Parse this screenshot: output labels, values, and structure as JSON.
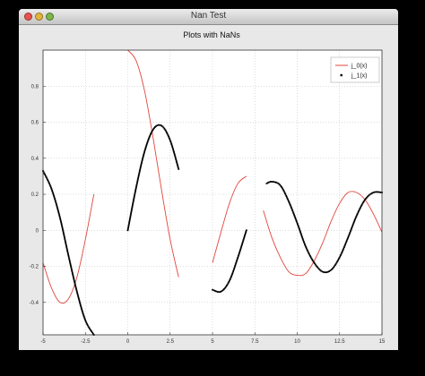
{
  "window": {
    "title": "Nan Test"
  },
  "chart_data": {
    "type": "line",
    "title": "Plots with NaNs",
    "xlabel": "",
    "ylabel": "",
    "xlim": [
      -5,
      15
    ],
    "ylim": [
      -0.58,
      1.0
    ],
    "grid": true,
    "legend_position": "top-right",
    "xticks": [
      -5,
      -2.5,
      0,
      2.5,
      5,
      7.5,
      10,
      12.5,
      15
    ],
    "xtick_labels": [
      "-5",
      "-2.5",
      "0",
      "2.5",
      "5",
      "7.5",
      "10",
      "12.5",
      "15"
    ],
    "yticks": [
      -0.4,
      -0.2,
      0,
      0.2,
      0.4,
      0.6,
      0.8
    ],
    "ytick_labels": [
      "-0.4",
      "-0.2",
      "0",
      "0.2",
      "0.4",
      "0.6",
      "0.8"
    ],
    "series": [
      {
        "name": "j_0(x)",
        "style": "line",
        "color": "#e0453c",
        "segments": [
          {
            "x": [
              -5.0,
              -4.5,
              -4.0,
              -3.5,
              -3.0,
              -2.5,
              -2.0
            ],
            "y": [
              -0.18,
              -0.32,
              -0.4,
              -0.38,
              -0.26,
              -0.05,
              0.2
            ]
          },
          {
            "x": [
              0.0,
              0.5,
              1.0,
              1.5,
              2.0,
              2.5,
              3.0
            ],
            "y": [
              1.0,
              0.94,
              0.77,
              0.51,
              0.22,
              -0.05,
              -0.26
            ]
          },
          {
            "x": [
              5.0,
              5.5,
              6.0,
              6.5,
              7.0
            ],
            "y": [
              -0.18,
              -0.01,
              0.15,
              0.26,
              0.3
            ]
          },
          {
            "x": [
              8.0,
              8.5,
              9.0,
              9.5,
              10.0,
              10.5,
              11.0,
              11.5,
              12.0,
              12.5,
              13.0,
              13.5,
              14.0,
              14.5,
              15.0
            ],
            "y": [
              0.11,
              -0.04,
              -0.15,
              -0.23,
              -0.25,
              -0.24,
              -0.17,
              -0.07,
              0.05,
              0.15,
              0.21,
              0.21,
              0.17,
              0.09,
              -0.01
            ]
          }
        ]
      },
      {
        "name": "j_1(x)",
        "style": "markers",
        "color": "#000000",
        "segments": [
          {
            "x": [
              -5.0,
              -4.5,
              -4.0,
              -3.5,
              -3.0,
              -2.5,
              -2.0
            ],
            "y": [
              0.33,
              0.23,
              0.07,
              -0.14,
              -0.34,
              -0.5,
              -0.58
            ]
          },
          {
            "x": [
              0.0,
              0.5,
              1.0,
              1.5,
              2.0,
              2.5,
              3.0
            ],
            "y": [
              0.0,
              0.24,
              0.44,
              0.56,
              0.58,
              0.5,
              0.34
            ]
          },
          {
            "x": [
              5.0,
              5.5,
              6.0,
              6.5,
              7.0
            ],
            "y": [
              -0.33,
              -0.34,
              -0.28,
              -0.15,
              0.0
            ]
          },
          {
            "x": [
              8.2,
              8.5,
              9.0,
              9.5,
              10.0,
              10.5,
              11.0,
              11.5,
              12.0,
              12.5,
              13.0,
              13.5,
              14.0,
              14.5,
              15.0
            ],
            "y": [
              0.26,
              0.27,
              0.25,
              0.16,
              0.04,
              -0.09,
              -0.18,
              -0.23,
              -0.22,
              -0.15,
              -0.04,
              0.08,
              0.17,
              0.21,
              0.21
            ]
          }
        ]
      }
    ]
  }
}
